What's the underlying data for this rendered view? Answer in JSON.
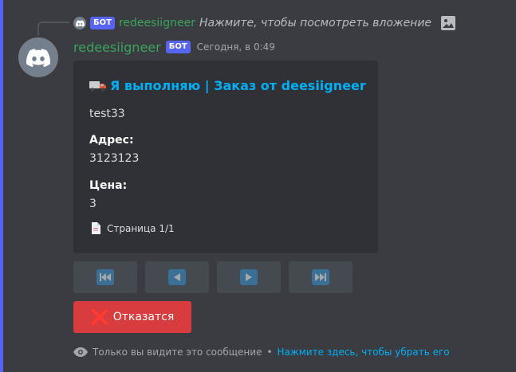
{
  "reply": {
    "bot_tag": "БОТ",
    "author": "redeesiigneer",
    "text": "Нажмите, чтобы посмотреть вложение",
    "attachment_icon": "image-icon"
  },
  "message": {
    "author": "redeesiigneer",
    "bot_tag": "БОТ",
    "timestamp": "Сегодня, в 0:49"
  },
  "embed": {
    "title": "Я выполняю | Заказ от deesiigneer",
    "title_emoji": "truck-icon",
    "description": "test33",
    "fields": [
      {
        "name": "Адрес:",
        "value": "3123123"
      },
      {
        "name": "Цена:",
        "value": "3"
      }
    ],
    "footer": "Страница 1/1"
  },
  "buttons": {
    "nav": [
      {
        "icon": "first-page-icon"
      },
      {
        "icon": "prev-page-icon"
      },
      {
        "icon": "next-page-icon"
      },
      {
        "icon": "last-page-icon"
      }
    ],
    "cancel_label": "Отказатся"
  },
  "ephemeral": {
    "note": "Только вы видите это сообщение",
    "separator": "•",
    "dismiss_link": "Нажмите здесь, чтобы убрать его"
  },
  "colors": {
    "accent": "#5865f2",
    "author_green": "#3ba55c",
    "link_blue": "#00aff4",
    "danger": "#d83c3e"
  }
}
